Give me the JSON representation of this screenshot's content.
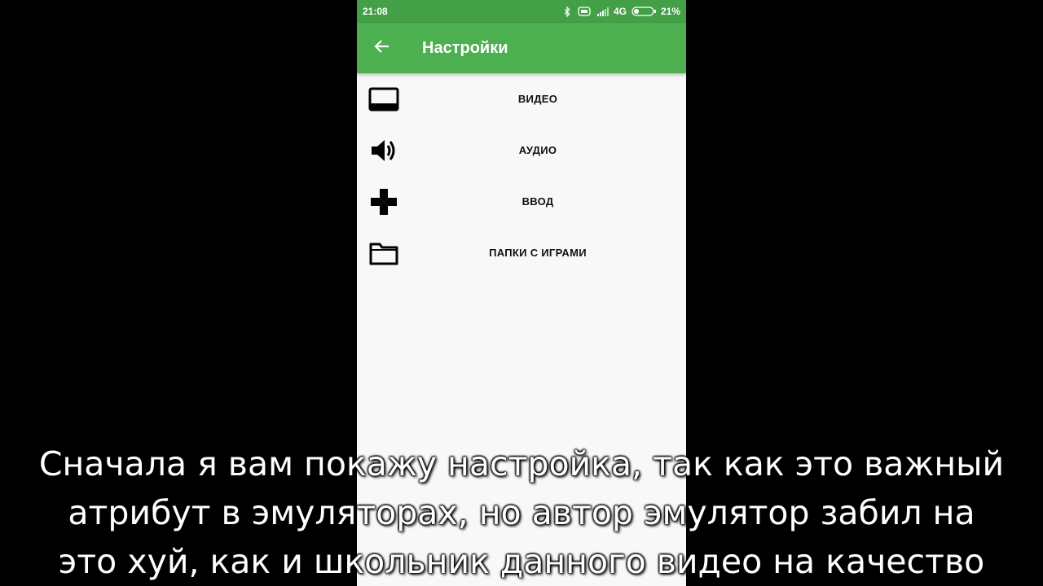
{
  "status_bar": {
    "time": "21:08",
    "network": "4G",
    "battery": "21%",
    "icons": [
      "bluetooth-icon",
      "vibrate-icon",
      "signal-icon",
      "battery-icon"
    ]
  },
  "app_bar": {
    "title": "Настройки",
    "back_icon": "arrow-back-icon",
    "color": "#4caf50",
    "status_color": "#43a047"
  },
  "menu": {
    "items": [
      {
        "label": "ВИДЕО",
        "icon": "monitor-icon"
      },
      {
        "label": "АУДИО",
        "icon": "speaker-icon"
      },
      {
        "label": "ВВОД",
        "icon": "gamepad-icon"
      },
      {
        "label": "ПАПКИ С ИГРАМИ",
        "icon": "folder-icon"
      }
    ]
  },
  "subtitle": {
    "lines": [
      "Сначала я вам покажу настройка, так как это важный",
      "атрибут в эмуляторах, но автор эмулятор забил на",
      "это хуй, как и школьник данного видео на качество"
    ]
  }
}
